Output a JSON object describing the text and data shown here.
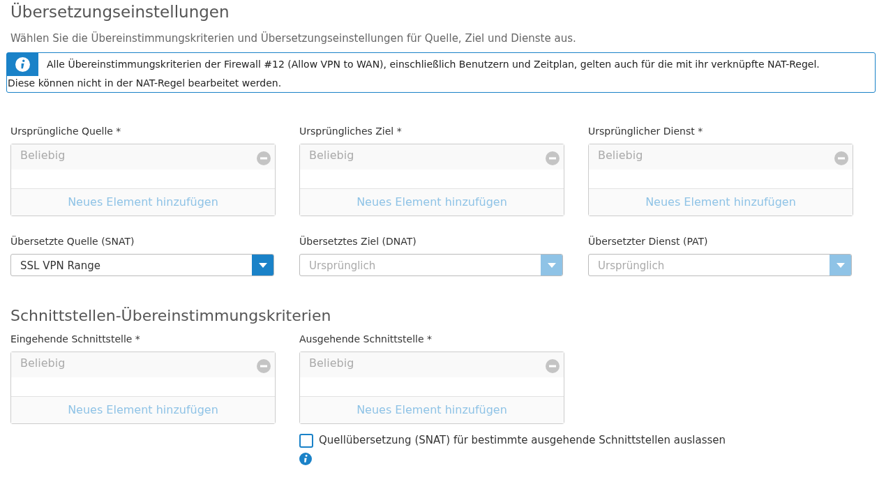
{
  "title": "Übersetzungseinstellungen",
  "description": "Wählen Sie die Übereinstimmungskriterien und Übersetzungseinstellungen für Quelle, Ziel und Dienste aus.",
  "info_box": {
    "line_1": "Alle Übereinstimmungskriterien der Firewall #12 (Allow VPN to WAN), einschließlich Benutzern und Zeitplan, gelten auch für die mit ihr verknüpfte NAT-Regel.",
    "line_2": "Diese können nicht in der NAT-Regel bearbeitet werden."
  },
  "original_fields": [
    {
      "label": "Ursprüngliche Quelle *",
      "placeholder": "Beliebig",
      "add_link": "Neues Element hinzufügen"
    },
    {
      "label": "Ursprüngliches Ziel *",
      "placeholder": "Beliebig",
      "add_link": "Neues Element hinzufügen"
    },
    {
      "label": "Ursprünglicher Dienst *",
      "placeholder": "Beliebig",
      "add_link": "Neues Element hinzufügen"
    }
  ],
  "translated_fields": [
    {
      "label": "Übersetzte Quelle (SNAT)",
      "value": "SSL VPN Range",
      "disabled": false
    },
    {
      "label": "Übersetztes Ziel (DNAT)",
      "value": "Ursprünglich",
      "disabled": true
    },
    {
      "label": "Übersetzter Dienst (PAT)",
      "value": "Ursprünglich",
      "disabled": true
    }
  ],
  "interface_section": {
    "title": "Schnittstellen-Übereinstimmungskriterien",
    "fields": [
      {
        "label": "Eingehende Schnittstelle *",
        "placeholder": "Beliebig",
        "add_link": "Neues Element hinzufügen"
      },
      {
        "label": "Ausgehende Schnittstelle *",
        "placeholder": "Beliebig",
        "add_link": "Neues Element hinzufügen"
      }
    ],
    "checkbox": {
      "label": "Quellübersetzung (SNAT) für bestimmte ausgehende Schnittstellen auslassen",
      "checked": false
    }
  }
}
